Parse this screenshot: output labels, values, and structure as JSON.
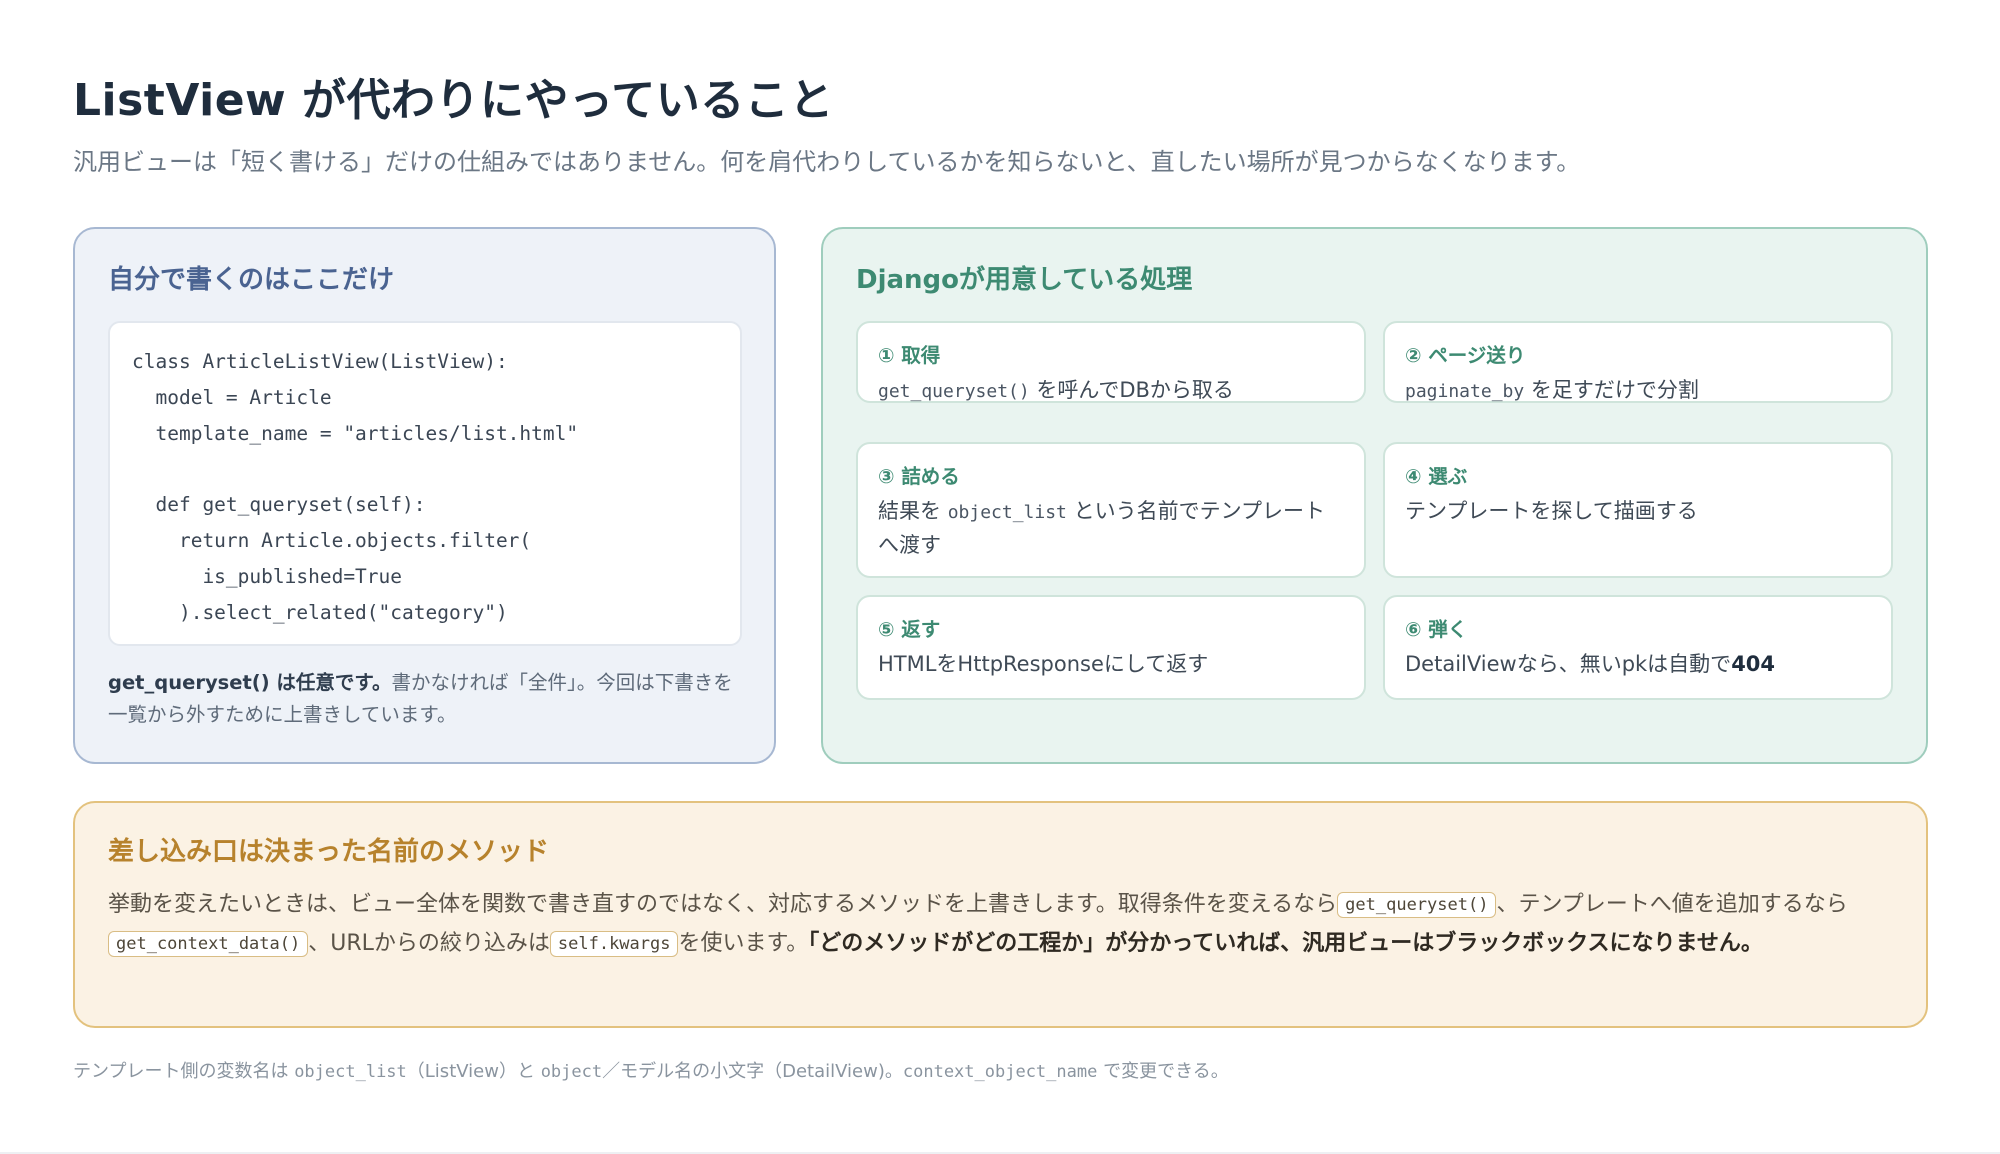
{
  "header": {
    "title": "ListView が代わりにやっていること",
    "subtitle": "汎用ビューは「短く書ける」だけの仕組みではありません。何を肩代わりしているかを知らないと、直したい場所が見つからなくなります。"
  },
  "left_panel": {
    "heading": "自分で書くのはここだけ",
    "code": [
      "class ArticleListView(ListView):",
      "  model = Article",
      "  template_name = \"articles/list.html\"",
      "",
      "  def get_queryset(self):",
      "    return Article.objects.filter(",
      "      is_published=True",
      "    ).select_related(\"category\")"
    ],
    "note_bold": "get_queryset() は任意です。",
    "note_rest": "書かなければ「全件」。今回は下書きを一覧から外すために上書きしています。"
  },
  "right_panel": {
    "heading": "Djangoが用意している処理",
    "steps": [
      {
        "title": "① 取得",
        "code": "get_queryset()",
        "text": " を呼んでDBから取る"
      },
      {
        "title": "② ページ送り",
        "code": "paginate_by",
        "text": " を足すだけで分割"
      },
      {
        "title": "③ 詰める",
        "pre": "結果を ",
        "code": "object_list",
        "text": " という名前でテンプレートへ渡す"
      },
      {
        "title": "④ 選ぶ",
        "text": "テンプレートを探して描画する"
      },
      {
        "title": "⑤ 返す",
        "text": "HTMLをHttpResponseにして返す"
      },
      {
        "title": "⑥ 弾く",
        "text": "DetailViewなら、無いpkは自動で",
        "bold": "404"
      }
    ]
  },
  "bottom_panel": {
    "heading": "差し込み口は決まった名前のメソッド",
    "text1": "挙動を変えたいときは、ビュー全体を関数で書き直すのではなく、対応するメソッドを上書きします。取得条件を変えるなら",
    "chip1": "get_queryset()",
    "text2": "、テンプレートへ値を追加するなら",
    "chip2": "get_context_data()",
    "text3": "、URLからの絞り込みは",
    "chip3": "self.kwargs",
    "text4": "を使います。",
    "bold": "「どのメソッドがどの工程か」が分かっていれば、汎用ビューはブラックボックスになりません。"
  },
  "footnote": {
    "t1": "テンプレート側の変数名は ",
    "c1": "object_list",
    "t2": "（ListView）と ",
    "c2": "object",
    "t3": "／モデル名の小文字（DetailView)。",
    "c3": "context_object_name",
    "t4": " で変更できる。"
  }
}
